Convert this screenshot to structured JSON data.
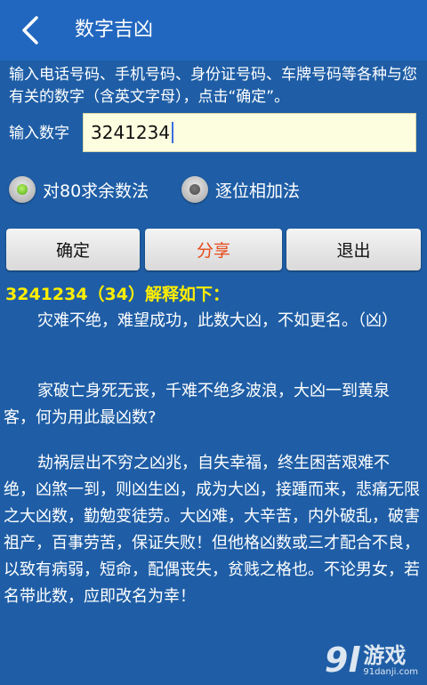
{
  "app": {
    "title": "数字吉凶"
  },
  "intro": "输入电话号码、手机号码、身份证号码、车牌号码等各种与您有关的数字（含英文字母），点击“确定”。",
  "input": {
    "label": "输入数字",
    "value": "3241234"
  },
  "radios": [
    {
      "label": "对80求余数法",
      "selected": true
    },
    {
      "label": "逐位相加法",
      "selected": false
    }
  ],
  "buttons": {
    "confirm": "确定",
    "share": "分享",
    "exit": "退出"
  },
  "result": {
    "heading": "3241234（34）解释如下：",
    "paragraphs": [
      "灾难不绝，难望成功，此数大凶，不如更名。（凶）",
      "家破亡身死无丧，千难不绝多波浪，大凶一到黄泉客，何为用此最凶数?",
      "劫祸层出不穷之凶兆，自失幸福，终生困苦艰难不绝，凶煞一到，则凶生凶，成为大凶，接踵而来，悲痛无限之大凶数，勤勉变徒劳。大凶难，大辛苦，内外破乱，破害祖产，百事劳苦，保证失败！但他格凶数或三才配合不良，以致有病弱，短命，配偶丧失，贫贱之格也。不论男女，若名带此数，应即改名为幸！"
    ]
  },
  "watermark": {
    "logo": "9l",
    "name": "游戏",
    "url": "91danji.com"
  }
}
